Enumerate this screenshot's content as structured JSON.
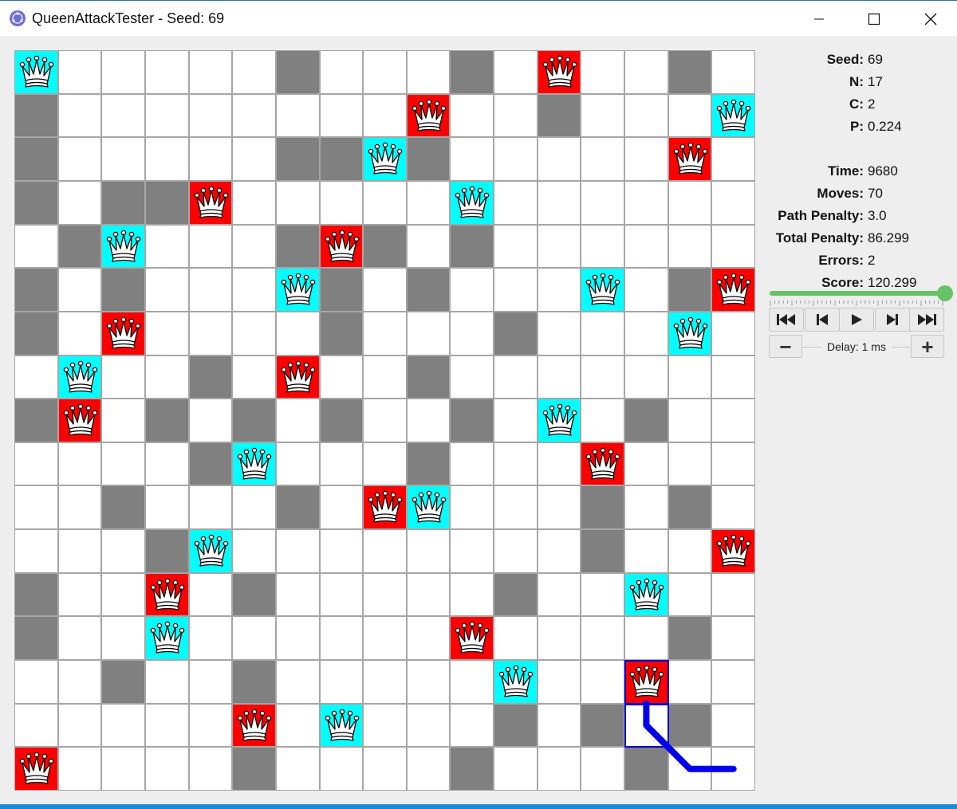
{
  "window": {
    "title": "QueenAttackTester - Seed: 69"
  },
  "board": {
    "size": 17,
    "colors": {
      "empty": "#ffffff",
      "wall": "#808080",
      "queen_ok": "#00ffff",
      "queen_attacked": "#ff0000",
      "grid": "#a6a6a6",
      "selection": "#0000cc",
      "path": "#0000ee"
    },
    "walls": [
      [
        0,
        6
      ],
      [
        0,
        10
      ],
      [
        0,
        15
      ],
      [
        1,
        0
      ],
      [
        1,
        12
      ],
      [
        2,
        0
      ],
      [
        2,
        6
      ],
      [
        2,
        7
      ],
      [
        2,
        9
      ],
      [
        3,
        0
      ],
      [
        3,
        2
      ],
      [
        3,
        3
      ],
      [
        4,
        1
      ],
      [
        4,
        6
      ],
      [
        4,
        8
      ],
      [
        4,
        10
      ],
      [
        5,
        0
      ],
      [
        5,
        2
      ],
      [
        5,
        7
      ],
      [
        5,
        9
      ],
      [
        5,
        15
      ],
      [
        6,
        0
      ],
      [
        6,
        7
      ],
      [
        6,
        11
      ],
      [
        7,
        4
      ],
      [
        7,
        9
      ],
      [
        8,
        0
      ],
      [
        8,
        3
      ],
      [
        8,
        5
      ],
      [
        8,
        7
      ],
      [
        8,
        10
      ],
      [
        8,
        14
      ],
      [
        9,
        4
      ],
      [
        9,
        9
      ],
      [
        10,
        2
      ],
      [
        10,
        6
      ],
      [
        10,
        13
      ],
      [
        10,
        15
      ],
      [
        11,
        3
      ],
      [
        11,
        13
      ],
      [
        12,
        0
      ],
      [
        12,
        5
      ],
      [
        12,
        11
      ],
      [
        13,
        0
      ],
      [
        13,
        15
      ],
      [
        14,
        2
      ],
      [
        14,
        5
      ],
      [
        15,
        11
      ],
      [
        15,
        13
      ],
      [
        15,
        15
      ],
      [
        16,
        5
      ],
      [
        16,
        10
      ],
      [
        16,
        14
      ]
    ],
    "queens": [
      {
        "r": 0,
        "c": 0,
        "s": "ok"
      },
      {
        "r": 0,
        "c": 12,
        "s": "attacked"
      },
      {
        "r": 1,
        "c": 9,
        "s": "attacked"
      },
      {
        "r": 1,
        "c": 16,
        "s": "ok"
      },
      {
        "r": 2,
        "c": 8,
        "s": "ok"
      },
      {
        "r": 2,
        "c": 15,
        "s": "attacked"
      },
      {
        "r": 3,
        "c": 4,
        "s": "attacked"
      },
      {
        "r": 3,
        "c": 10,
        "s": "ok"
      },
      {
        "r": 4,
        "c": 2,
        "s": "ok"
      },
      {
        "r": 4,
        "c": 7,
        "s": "attacked"
      },
      {
        "r": 5,
        "c": 6,
        "s": "ok"
      },
      {
        "r": 5,
        "c": 13,
        "s": "ok"
      },
      {
        "r": 5,
        "c": 16,
        "s": "attacked"
      },
      {
        "r": 6,
        "c": 2,
        "s": "attacked"
      },
      {
        "r": 6,
        "c": 15,
        "s": "ok"
      },
      {
        "r": 7,
        "c": 1,
        "s": "ok"
      },
      {
        "r": 7,
        "c": 6,
        "s": "attacked"
      },
      {
        "r": 8,
        "c": 1,
        "s": "attacked"
      },
      {
        "r": 8,
        "c": 12,
        "s": "ok"
      },
      {
        "r": 9,
        "c": 5,
        "s": "ok"
      },
      {
        "r": 9,
        "c": 13,
        "s": "attacked"
      },
      {
        "r": 10,
        "c": 8,
        "s": "attacked"
      },
      {
        "r": 10,
        "c": 9,
        "s": "ok"
      },
      {
        "r": 11,
        "c": 4,
        "s": "ok"
      },
      {
        "r": 11,
        "c": 16,
        "s": "attacked"
      },
      {
        "r": 12,
        "c": 3,
        "s": "attacked"
      },
      {
        "r": 12,
        "c": 14,
        "s": "ok"
      },
      {
        "r": 13,
        "c": 3,
        "s": "ok"
      },
      {
        "r": 13,
        "c": 10,
        "s": "attacked"
      },
      {
        "r": 14,
        "c": 11,
        "s": "ok"
      },
      {
        "r": 14,
        "c": 14,
        "s": "attacked"
      },
      {
        "r": 15,
        "c": 5,
        "s": "attacked"
      },
      {
        "r": 15,
        "c": 7,
        "s": "ok"
      },
      {
        "r": 16,
        "c": 0,
        "s": "attacked"
      }
    ],
    "selected_cells": [
      [
        14,
        14
      ],
      [
        15,
        14
      ]
    ],
    "path_cells": [
      [
        15,
        14
      ],
      [
        16,
        15
      ],
      [
        16,
        16
      ]
    ]
  },
  "info": {
    "seed_label": "Seed:",
    "seed_value": "69",
    "n_label": "N:",
    "n_value": "17",
    "c_label": "C:",
    "c_value": "2",
    "p_label": "P:",
    "p_value": "0.224",
    "time_label": "Time:",
    "time_value": "9680",
    "moves_label": "Moves:",
    "moves_value": "70",
    "path_penalty_label": "Path Penalty:",
    "path_penalty_value": "3.0",
    "total_penalty_label": "Total Penalty:",
    "total_penalty_value": "86.299",
    "errors_label": "Errors:",
    "errors_value": "2",
    "score_label": "Score:",
    "score_value": "120.299"
  },
  "controls": {
    "slider_position": 1.0,
    "buttons": [
      "skip-to-start-icon",
      "step-back-icon",
      "play-icon",
      "step-forward-icon",
      "skip-to-end-icon"
    ],
    "minus_label": "−",
    "plus_label": "+",
    "delay_text": "Delay: 1 ms"
  }
}
